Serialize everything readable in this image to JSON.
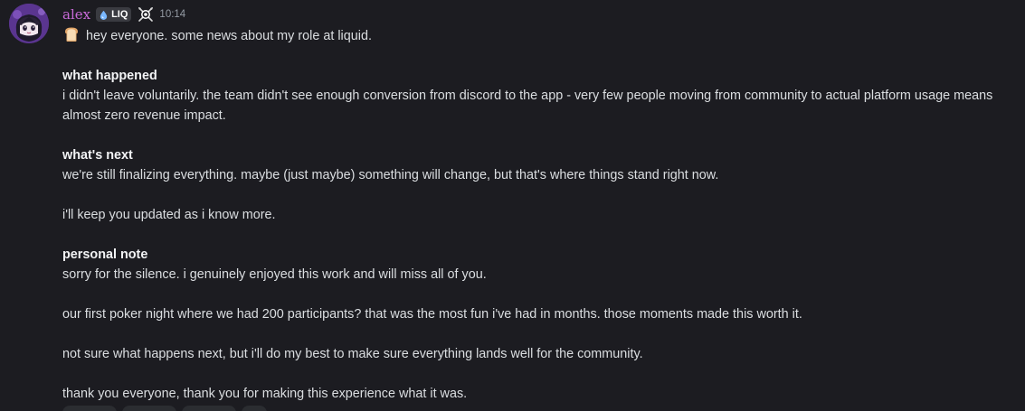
{
  "author": {
    "username": "alex",
    "guild_tag": "LIQ",
    "guild_tag_icon": "liquid-drop-icon",
    "badge_icon": "crossed-swords-badge-icon",
    "timestamp": "10:14",
    "avatar": "anime-avatar",
    "name_color": "#c86ad8"
  },
  "message": {
    "intro_emoji": "bread-emoji",
    "intro": "hey everyone. some news about my role at liquid.",
    "section1": {
      "heading": "what happened",
      "body": "i didn't leave voluntarily. the team didn't see enough conversion from discord to the app - very few people moving from community to actual platform usage means almost zero revenue impact."
    },
    "section2": {
      "heading": "what's next",
      "body": "we're still finalizing everything. maybe (just maybe) something will change, but that's where things stand right now.",
      "followup": "i'll keep you updated as i know more."
    },
    "section3": {
      "heading": "personal note",
      "body1": "sorry for the silence. i genuinely enjoyed this work and will miss all of you.",
      "body2": "our first poker night where we had 200 participants? that was the most fun i've had in months. those moments made this worth it.",
      "body3": "not sure what happens next, but i'll do my best to make sure everything lands well for the community.",
      "body4": "thank you everyone, thank you for making this experience what it was."
    }
  },
  "colors": {
    "background": "#1c1c21",
    "text": "#dbdee1",
    "heading": "#f2f3f5",
    "muted": "#949ba4"
  }
}
